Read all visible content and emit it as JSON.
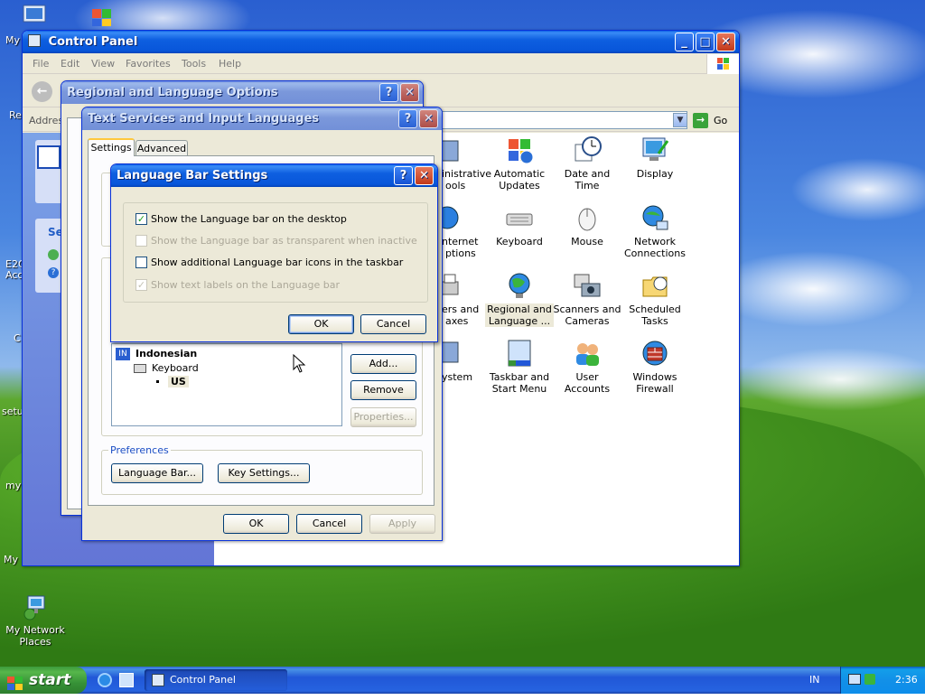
{
  "desktop": {
    "icons": [
      {
        "label": "My Network Places",
        "icon": "network-places-icon"
      }
    ],
    "fragments": [
      "My",
      "Re",
      "E2C",
      "Acc",
      "C",
      "setu",
      "myp",
      "My I"
    ]
  },
  "control_panel": {
    "title": "Control Panel",
    "menu": [
      "File",
      "Edit",
      "View",
      "Favorites",
      "Tools",
      "Help"
    ],
    "address_label": "Addres",
    "go_label": "Go",
    "items": [
      {
        "label": "Administrative Tools",
        "icon": "admin-tools-icon"
      },
      {
        "label": "Automatic Updates",
        "icon": "automatic-updates-icon"
      },
      {
        "label": "Date and Time",
        "icon": "date-time-icon"
      },
      {
        "label": "Display",
        "icon": "display-icon"
      },
      {
        "label": "Internet Options",
        "icon": "internet-options-icon"
      },
      {
        "label": "Keyboard",
        "icon": "keyboard-icon"
      },
      {
        "label": "Mouse",
        "icon": "mouse-icon"
      },
      {
        "label": "Network Connections",
        "icon": "network-connections-icon"
      },
      {
        "label": "Printers and Faxes",
        "icon": "printers-icon"
      },
      {
        "label": "Regional and Language ...",
        "icon": "regional-language-icon"
      },
      {
        "label": "Scanners and Cameras",
        "icon": "scanners-icon"
      },
      {
        "label": "Scheduled Tasks",
        "icon": "scheduled-tasks-icon"
      },
      {
        "label": "System",
        "icon": "system-icon"
      },
      {
        "label": "Taskbar and Start Menu",
        "icon": "taskbar-icon"
      },
      {
        "label": "User Accounts",
        "icon": "user-accounts-icon"
      },
      {
        "label": "Windows Firewall",
        "icon": "firewall-icon"
      }
    ],
    "visible_fragments": {
      "admin_1": "inistrative",
      "admin_2": "ools",
      "inet_1": "nternet",
      "inet_2": "ptions",
      "print_1": "ers and",
      "print_2": "axes",
      "system": "ystem"
    },
    "side_panel_text": "Se"
  },
  "regional_dialog": {
    "title": "Regional and Language Options"
  },
  "text_services_dialog": {
    "title": "Text Services and Input Languages",
    "tabs": [
      "Settings",
      "Advanced"
    ],
    "lang_badge": "IN",
    "language": "Indonesian",
    "service_type": "Keyboard",
    "layout": "US",
    "buttons": {
      "add": "Add...",
      "remove": "Remove",
      "properties": "Properties..."
    },
    "preferences_label": "Preferences",
    "language_bar_btn": "Language Bar...",
    "key_settings_btn": "Key Settings...",
    "ok": "OK",
    "cancel": "Cancel",
    "apply": "Apply"
  },
  "language_bar_dialog": {
    "title": "Language Bar Settings",
    "options": [
      {
        "label": "Show the Language bar on the desktop",
        "checked": true,
        "enabled": true
      },
      {
        "label": "Show the Language bar as transparent when inactive",
        "checked": false,
        "enabled": false
      },
      {
        "label": "Show additional Language bar icons in the taskbar",
        "checked": false,
        "enabled": true
      },
      {
        "label": "Show text labels on the Language bar",
        "checked": true,
        "enabled": false
      }
    ],
    "ok": "OK",
    "cancel": "Cancel"
  },
  "taskbar": {
    "start_label": "start",
    "task_button": "Control Panel",
    "lang_indicator": "IN",
    "clock": "2:36"
  },
  "colors": {
    "title_active": "#0856da",
    "dialog_face": "#ece9d8",
    "taskbar": "#2157d7",
    "start_green": "#379237"
  }
}
